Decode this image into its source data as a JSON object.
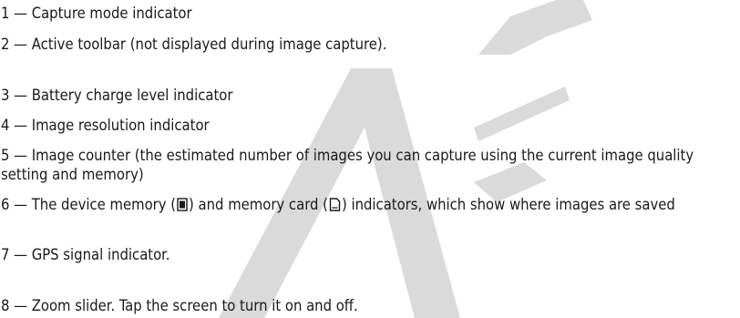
{
  "items": [
    "1 — Capture mode indicator",
    "2 — Active toolbar (not displayed during image capture).",
    "3 — Battery charge level indicator",
    "4 — Image resolution indicator",
    "5 — Image counter (the estimated number of images you can capture using the current image quality setting and memory)",
    {
      "before": "6 — The device memory (",
      "middle": ") and memory card (",
      "after": ") indicators, which show where images are saved",
      "icons": [
        "device-memory-icon",
        "memory-card-icon"
      ]
    },
    "7 — GPS signal indicator.",
    "8 — Zoom slider. Tap the screen to turn it on and off."
  ],
  "watermark": {
    "text": "AFT",
    "color": "#d9d9d9"
  }
}
